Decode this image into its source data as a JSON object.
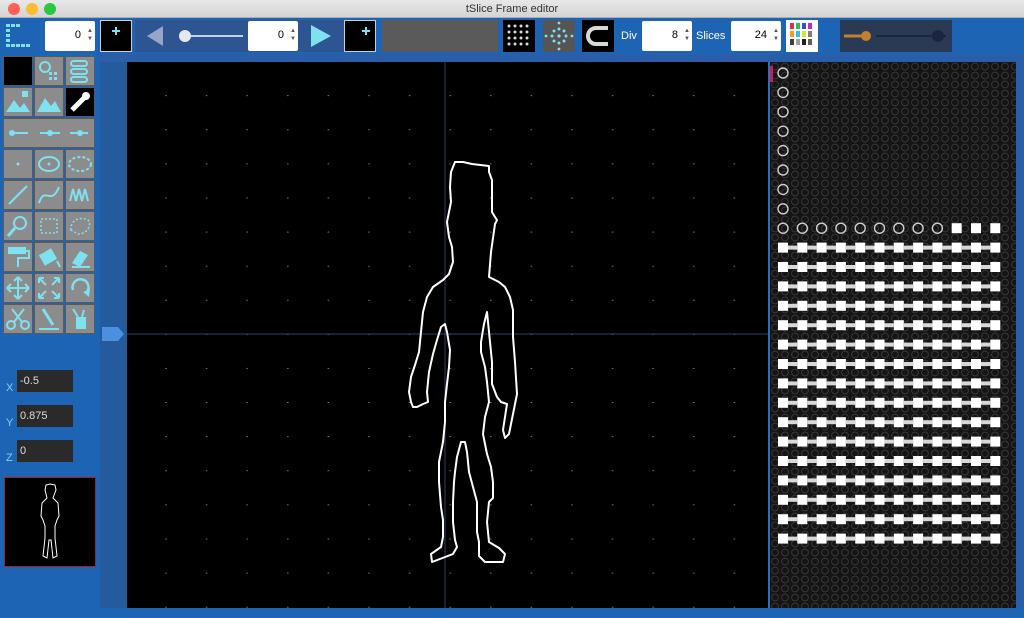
{
  "window": {
    "title": "tSlice Frame editor"
  },
  "toolbar": {
    "frame_value": "0",
    "slider_value": "0",
    "div_label": "Div",
    "div_value": "8",
    "slices_label": "Slices",
    "slices_value": "24"
  },
  "coords": {
    "x_label": "X",
    "x_value": "-0.5",
    "y_label": "Y",
    "y_value": "0.875",
    "z_label": "Z",
    "z_value": "0"
  },
  "colors": {
    "accent": "#1e64b4",
    "icon": "#7fe0f0",
    "canvas_bg": "#000000"
  }
}
